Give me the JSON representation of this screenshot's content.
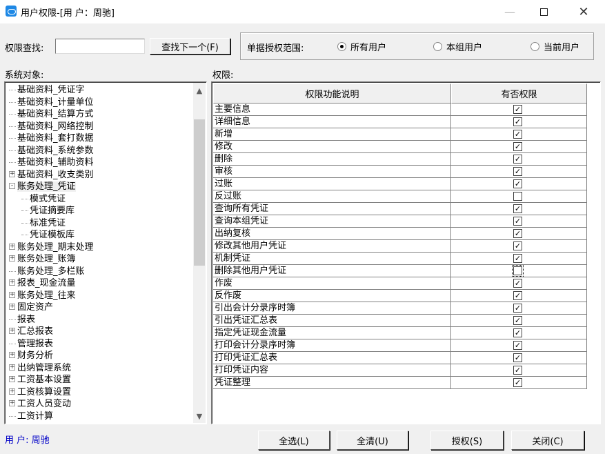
{
  "window": {
    "title": "用户权限-[用 户：周驰]",
    "minimize": "—",
    "close": "✕"
  },
  "search": {
    "label": "权限查找:",
    "value": "",
    "find_next": "查找下一个(F)"
  },
  "scope": {
    "label": "单据授权范围:",
    "options": [
      {
        "label": "所有用户",
        "selected": true
      },
      {
        "label": "本组用户",
        "selected": false
      },
      {
        "label": "当前用户",
        "selected": false
      }
    ]
  },
  "tree": {
    "label": "系统对象:",
    "items": [
      {
        "label": "基础资料_凭证字",
        "expander": "",
        "level": 0
      },
      {
        "label": "基础资料_计量单位",
        "expander": "",
        "level": 0
      },
      {
        "label": "基础资料_结算方式",
        "expander": "",
        "level": 0
      },
      {
        "label": "基础资料_网络控制",
        "expander": "",
        "level": 0
      },
      {
        "label": "基础资料_套打数据",
        "expander": "",
        "level": 0
      },
      {
        "label": "基础资料_系统参数",
        "expander": "",
        "level": 0
      },
      {
        "label": "基础资料_辅助资料",
        "expander": "",
        "level": 0
      },
      {
        "label": "基础资料_收支类别",
        "expander": "+",
        "level": 0
      },
      {
        "label": "账务处理_凭证",
        "expander": "-",
        "level": 0,
        "selected": true
      },
      {
        "label": "模式凭证",
        "expander": "",
        "level": 1
      },
      {
        "label": "凭证摘要库",
        "expander": "",
        "level": 1
      },
      {
        "label": "标准凭证",
        "expander": "",
        "level": 1
      },
      {
        "label": "凭证模板库",
        "expander": "",
        "level": 1
      },
      {
        "label": "账务处理_期末处理",
        "expander": "+",
        "level": 0
      },
      {
        "label": "账务处理_账簿",
        "expander": "+",
        "level": 0
      },
      {
        "label": "账务处理_多栏账",
        "expander": "",
        "level": 0
      },
      {
        "label": "报表_现金流量",
        "expander": "+",
        "level": 0
      },
      {
        "label": "账务处理_往来",
        "expander": "+",
        "level": 0
      },
      {
        "label": "固定资产",
        "expander": "+",
        "level": 0
      },
      {
        "label": "报表",
        "expander": "",
        "level": 0
      },
      {
        "label": "汇总报表",
        "expander": "+",
        "level": 0
      },
      {
        "label": "管理报表",
        "expander": "",
        "level": 0
      },
      {
        "label": "财务分析",
        "expander": "+",
        "level": 0
      },
      {
        "label": "出纳管理系统",
        "expander": "+",
        "level": 0
      },
      {
        "label": "工资基本设置",
        "expander": "+",
        "level": 0
      },
      {
        "label": "工资核算设置",
        "expander": "+",
        "level": 0
      },
      {
        "label": "工资人员变动",
        "expander": "+",
        "level": 0
      },
      {
        "label": "工资计算",
        "expander": "",
        "level": 0
      }
    ],
    "scroll_up": "▲",
    "scroll_down": "▼"
  },
  "permissions": {
    "label": "权限:",
    "columns": [
      "权限功能说明",
      "有否权限"
    ],
    "rows": [
      {
        "name": "主要信息",
        "granted": true
      },
      {
        "name": "详细信息",
        "granted": true
      },
      {
        "name": "新增",
        "granted": true
      },
      {
        "name": "修改",
        "granted": true
      },
      {
        "name": "删除",
        "granted": true
      },
      {
        "name": "审核",
        "granted": true
      },
      {
        "name": "过账",
        "granted": true
      },
      {
        "name": "反过账",
        "granted": false
      },
      {
        "name": "查询所有凭证",
        "granted": true
      },
      {
        "name": "查询本组凭证",
        "granted": true
      },
      {
        "name": "出纳复核",
        "granted": true
      },
      {
        "name": "修改其他用户凭证",
        "granted": true
      },
      {
        "name": "机制凭证",
        "granted": true
      },
      {
        "name": "删除其他用户凭证",
        "granted": false,
        "focused": true
      },
      {
        "name": "作废",
        "granted": true
      },
      {
        "name": "反作废",
        "granted": true
      },
      {
        "name": "引出会计分录序时簿",
        "granted": true
      },
      {
        "name": "引出凭证汇总表",
        "granted": true
      },
      {
        "name": "指定凭证现金流量",
        "granted": true
      },
      {
        "name": "打印会计分录序时簿",
        "granted": true
      },
      {
        "name": "打印凭证汇总表",
        "granted": true
      },
      {
        "name": "打印凭证内容",
        "granted": true
      },
      {
        "name": "凭证整理",
        "granted": true
      }
    ]
  },
  "footer": {
    "user_label": "用 户: 周驰",
    "select_all": "全选(L)",
    "clear_all": "全清(U)",
    "grant": "授权(S)",
    "close": "关闭(C)"
  }
}
